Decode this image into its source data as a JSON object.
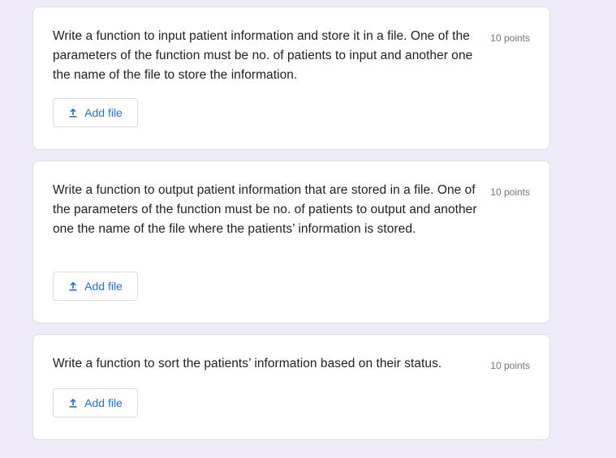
{
  "questions": [
    {
      "text": "Write a function to input patient information and store it in a file. One of the parameters of the function must be no. of patients to input and another one the name of the file to store the information.",
      "points": "10 points",
      "button_label": "Add file",
      "button_icon": "upload-icon"
    },
    {
      "text": "Write a function to output patient information that are stored in a file. One of the parameters of the function must be no. of patients to output and another one the name of the file where the patients’ information is stored.",
      "points": "10 points",
      "button_label": "Add file",
      "button_icon": "upload-icon"
    },
    {
      "text": "Write a function to sort the patients’ information based on their status.",
      "points": "10 points",
      "button_label": "Add file",
      "button_icon": "upload-icon"
    }
  ],
  "colors": {
    "page_background": "#f0ebf8",
    "card_background": "#ffffff",
    "accent": "#1a73e8",
    "text": "#202124",
    "muted": "#70757a"
  }
}
